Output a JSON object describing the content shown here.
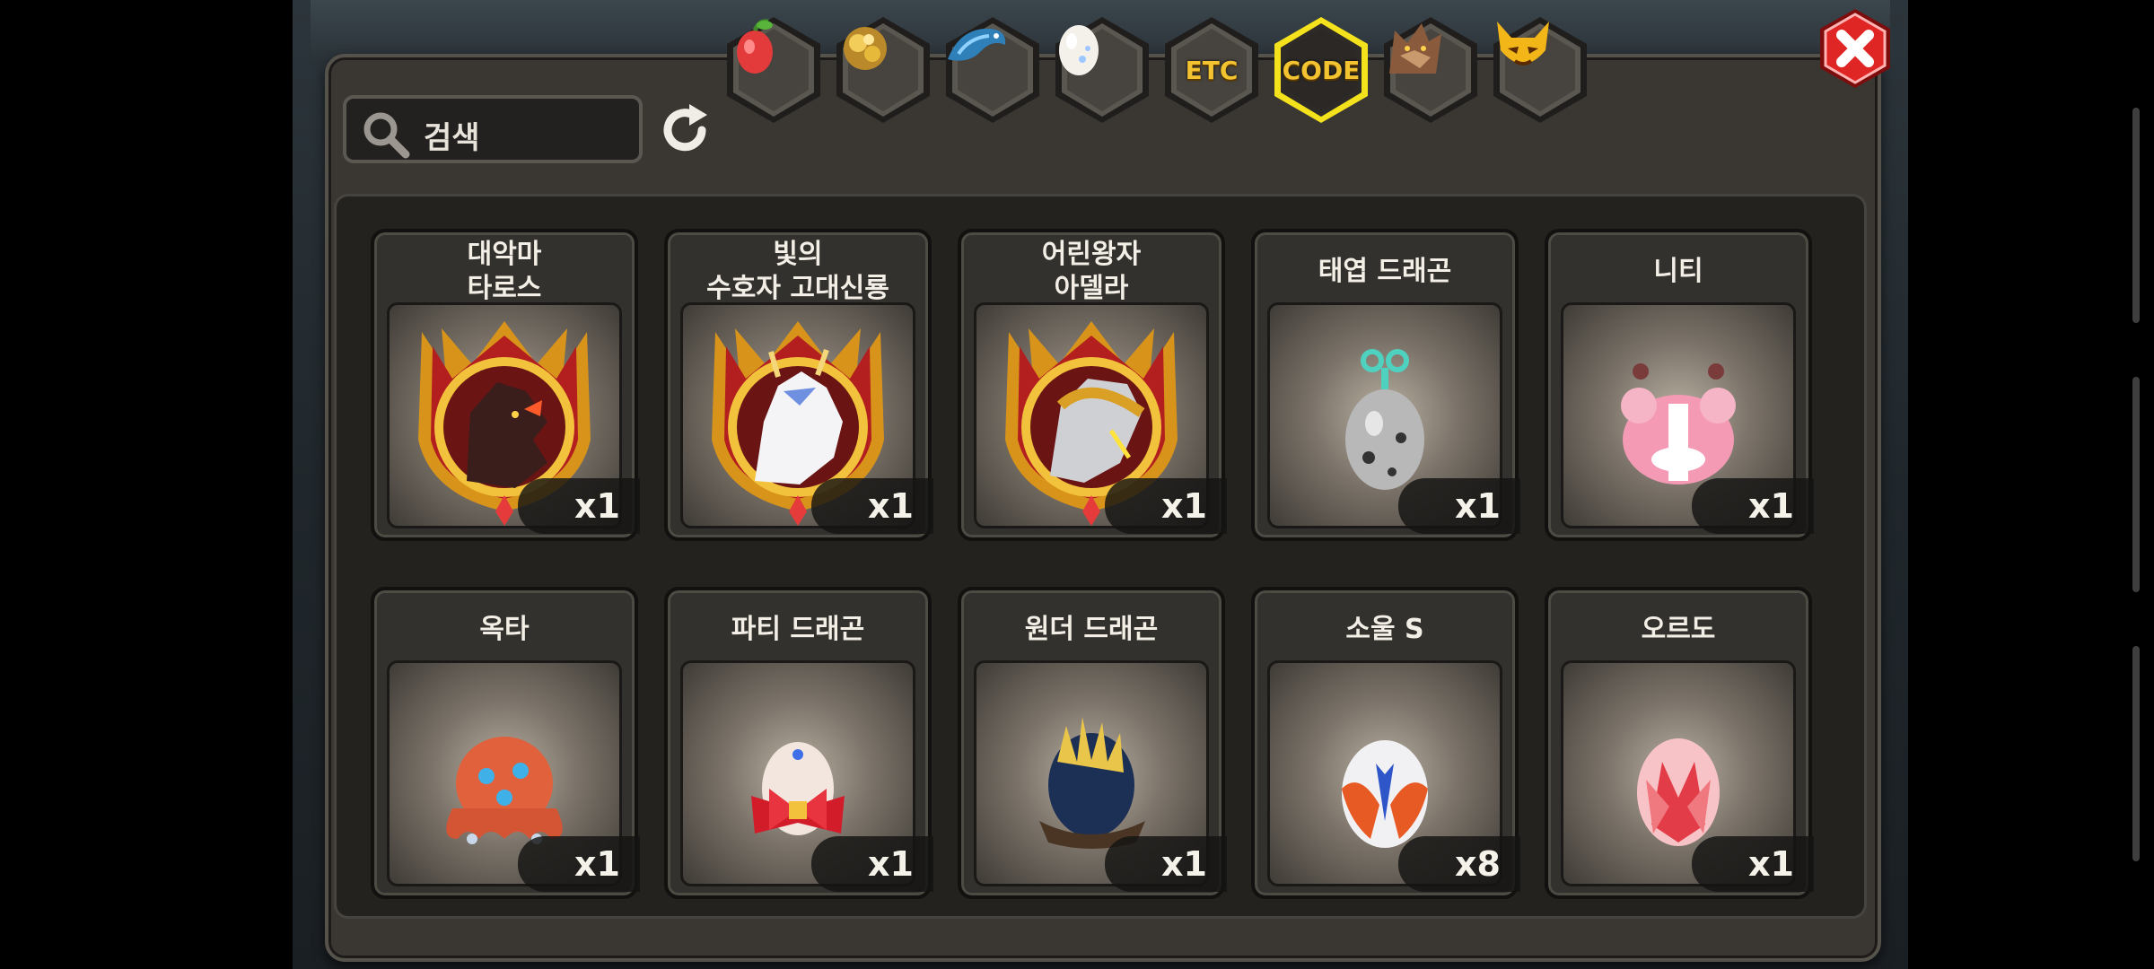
{
  "search": {
    "placeholder": "검색"
  },
  "tabs": [
    {
      "name": "fruit",
      "icon": "red-fruit-icon"
    },
    {
      "name": "material",
      "icon": "gold-ore-icon"
    },
    {
      "name": "dragon-skin",
      "icon": "blue-dragon-icon"
    },
    {
      "name": "egg",
      "icon": "egg-icon"
    },
    {
      "name": "etc",
      "label": "ETC"
    },
    {
      "name": "code",
      "label": "CODE",
      "selected": true
    },
    {
      "name": "werewolf",
      "icon": "werewolf-icon"
    },
    {
      "name": "mask",
      "icon": "horned-mask-icon"
    }
  ],
  "items": [
    {
      "name": "대악마\n타로스",
      "count": "x1",
      "icon": "demon-dragon-medal-icon"
    },
    {
      "name": "빛의\n수호자 고대신룡",
      "count": "x1",
      "icon": "white-dragon-medal-icon"
    },
    {
      "name": "어린왕자\n아델라",
      "count": "x1",
      "icon": "armored-dragon-medal-icon"
    },
    {
      "name": "태엽 드래곤",
      "count": "x1",
      "icon": "clockwork-egg-icon"
    },
    {
      "name": "니티",
      "count": "x1",
      "icon": "pink-bow-creature-icon"
    },
    {
      "name": "옥타",
      "count": "x1",
      "icon": "octopus-egg-icon"
    },
    {
      "name": "파티 드래곤",
      "count": "x1",
      "icon": "ribbon-egg-icon"
    },
    {
      "name": "원더 드래곤",
      "count": "x1",
      "icon": "crystal-nest-egg-icon"
    },
    {
      "name": "소울 S",
      "count": "x8",
      "icon": "red-blue-egg-icon"
    },
    {
      "name": "오르도",
      "count": "x1",
      "icon": "pink-crystal-egg-icon"
    }
  ]
}
